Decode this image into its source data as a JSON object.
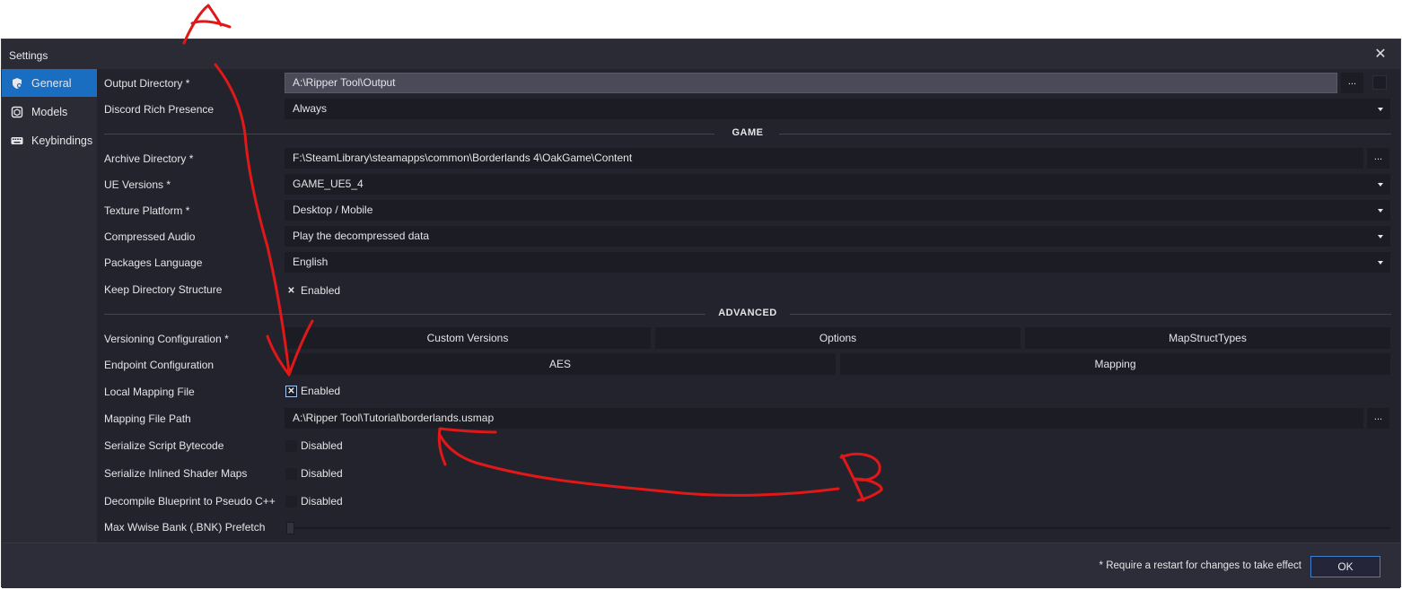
{
  "window": {
    "title": "Settings"
  },
  "sidebar": {
    "items": [
      {
        "label": "General",
        "icon": "shield-gear-icon",
        "active": true
      },
      {
        "label": "Models",
        "icon": "cube-icon",
        "active": false
      },
      {
        "label": "Keybindings",
        "icon": "keyboard-icon",
        "active": false
      }
    ]
  },
  "general": {
    "output_directory": {
      "label": "Output Directory *",
      "value": "A:\\Ripper Tool\\Output",
      "browse": "..."
    },
    "discord_rich_presence": {
      "label": "Discord Rich Presence",
      "value": "Always"
    }
  },
  "game_section": {
    "heading": "GAME",
    "archive_directory": {
      "label": "Archive Directory *",
      "value": "F:\\SteamLibrary\\steamapps\\common\\Borderlands 4\\OakGame\\Content",
      "browse": "..."
    },
    "ue_versions": {
      "label": "UE Versions *",
      "value": "GAME_UE5_4"
    },
    "texture_platform": {
      "label": "Texture Platform *",
      "value": "Desktop / Mobile"
    },
    "compressed_audio": {
      "label": "Compressed Audio",
      "value": "Play the decompressed data"
    },
    "packages_language": {
      "label": "Packages Language",
      "value": "English"
    },
    "keep_directory_structure": {
      "label": "Keep Directory Structure",
      "state": "Enabled",
      "checked": true
    }
  },
  "advanced_section": {
    "heading": "ADVANCED",
    "versioning_configuration": {
      "label": "Versioning Configuration *",
      "buttons": [
        "Custom Versions",
        "Options",
        "MapStructTypes"
      ]
    },
    "endpoint_configuration": {
      "label": "Endpoint Configuration",
      "buttons": [
        "AES",
        "Mapping"
      ]
    },
    "local_mapping_file": {
      "label": "Local Mapping File",
      "state": "Enabled",
      "checked": true
    },
    "mapping_file_path": {
      "label": "Mapping File Path",
      "value": "A:\\Ripper Tool\\Tutorial\\borderlands.usmap",
      "browse": "..."
    },
    "serialize_script_bytecode": {
      "label": "Serialize Script Bytecode",
      "state": "Disabled",
      "checked": false
    },
    "serialize_inlined_shader_maps": {
      "label": "Serialize Inlined Shader Maps",
      "state": "Disabled",
      "checked": false
    },
    "decompile_blueprint": {
      "label": "Decompile Blueprint to Pseudo C++",
      "state": "Disabled",
      "checked": false
    },
    "max_wwise_bank_prefetch": {
      "label": "Max Wwise Bank (.BNK) Prefetch",
      "level": 0
    }
  },
  "footer": {
    "note": "* Require a restart for changes to take effect",
    "ok_label": "OK"
  },
  "annotations": {
    "a_label": "A",
    "b_label": "B",
    "color": "#e01818"
  },
  "colors": {
    "accent": "#1a6ec2",
    "window_bg": "#2b2b36",
    "content_bg": "#23232d",
    "field_bg": "#1c1c24"
  }
}
